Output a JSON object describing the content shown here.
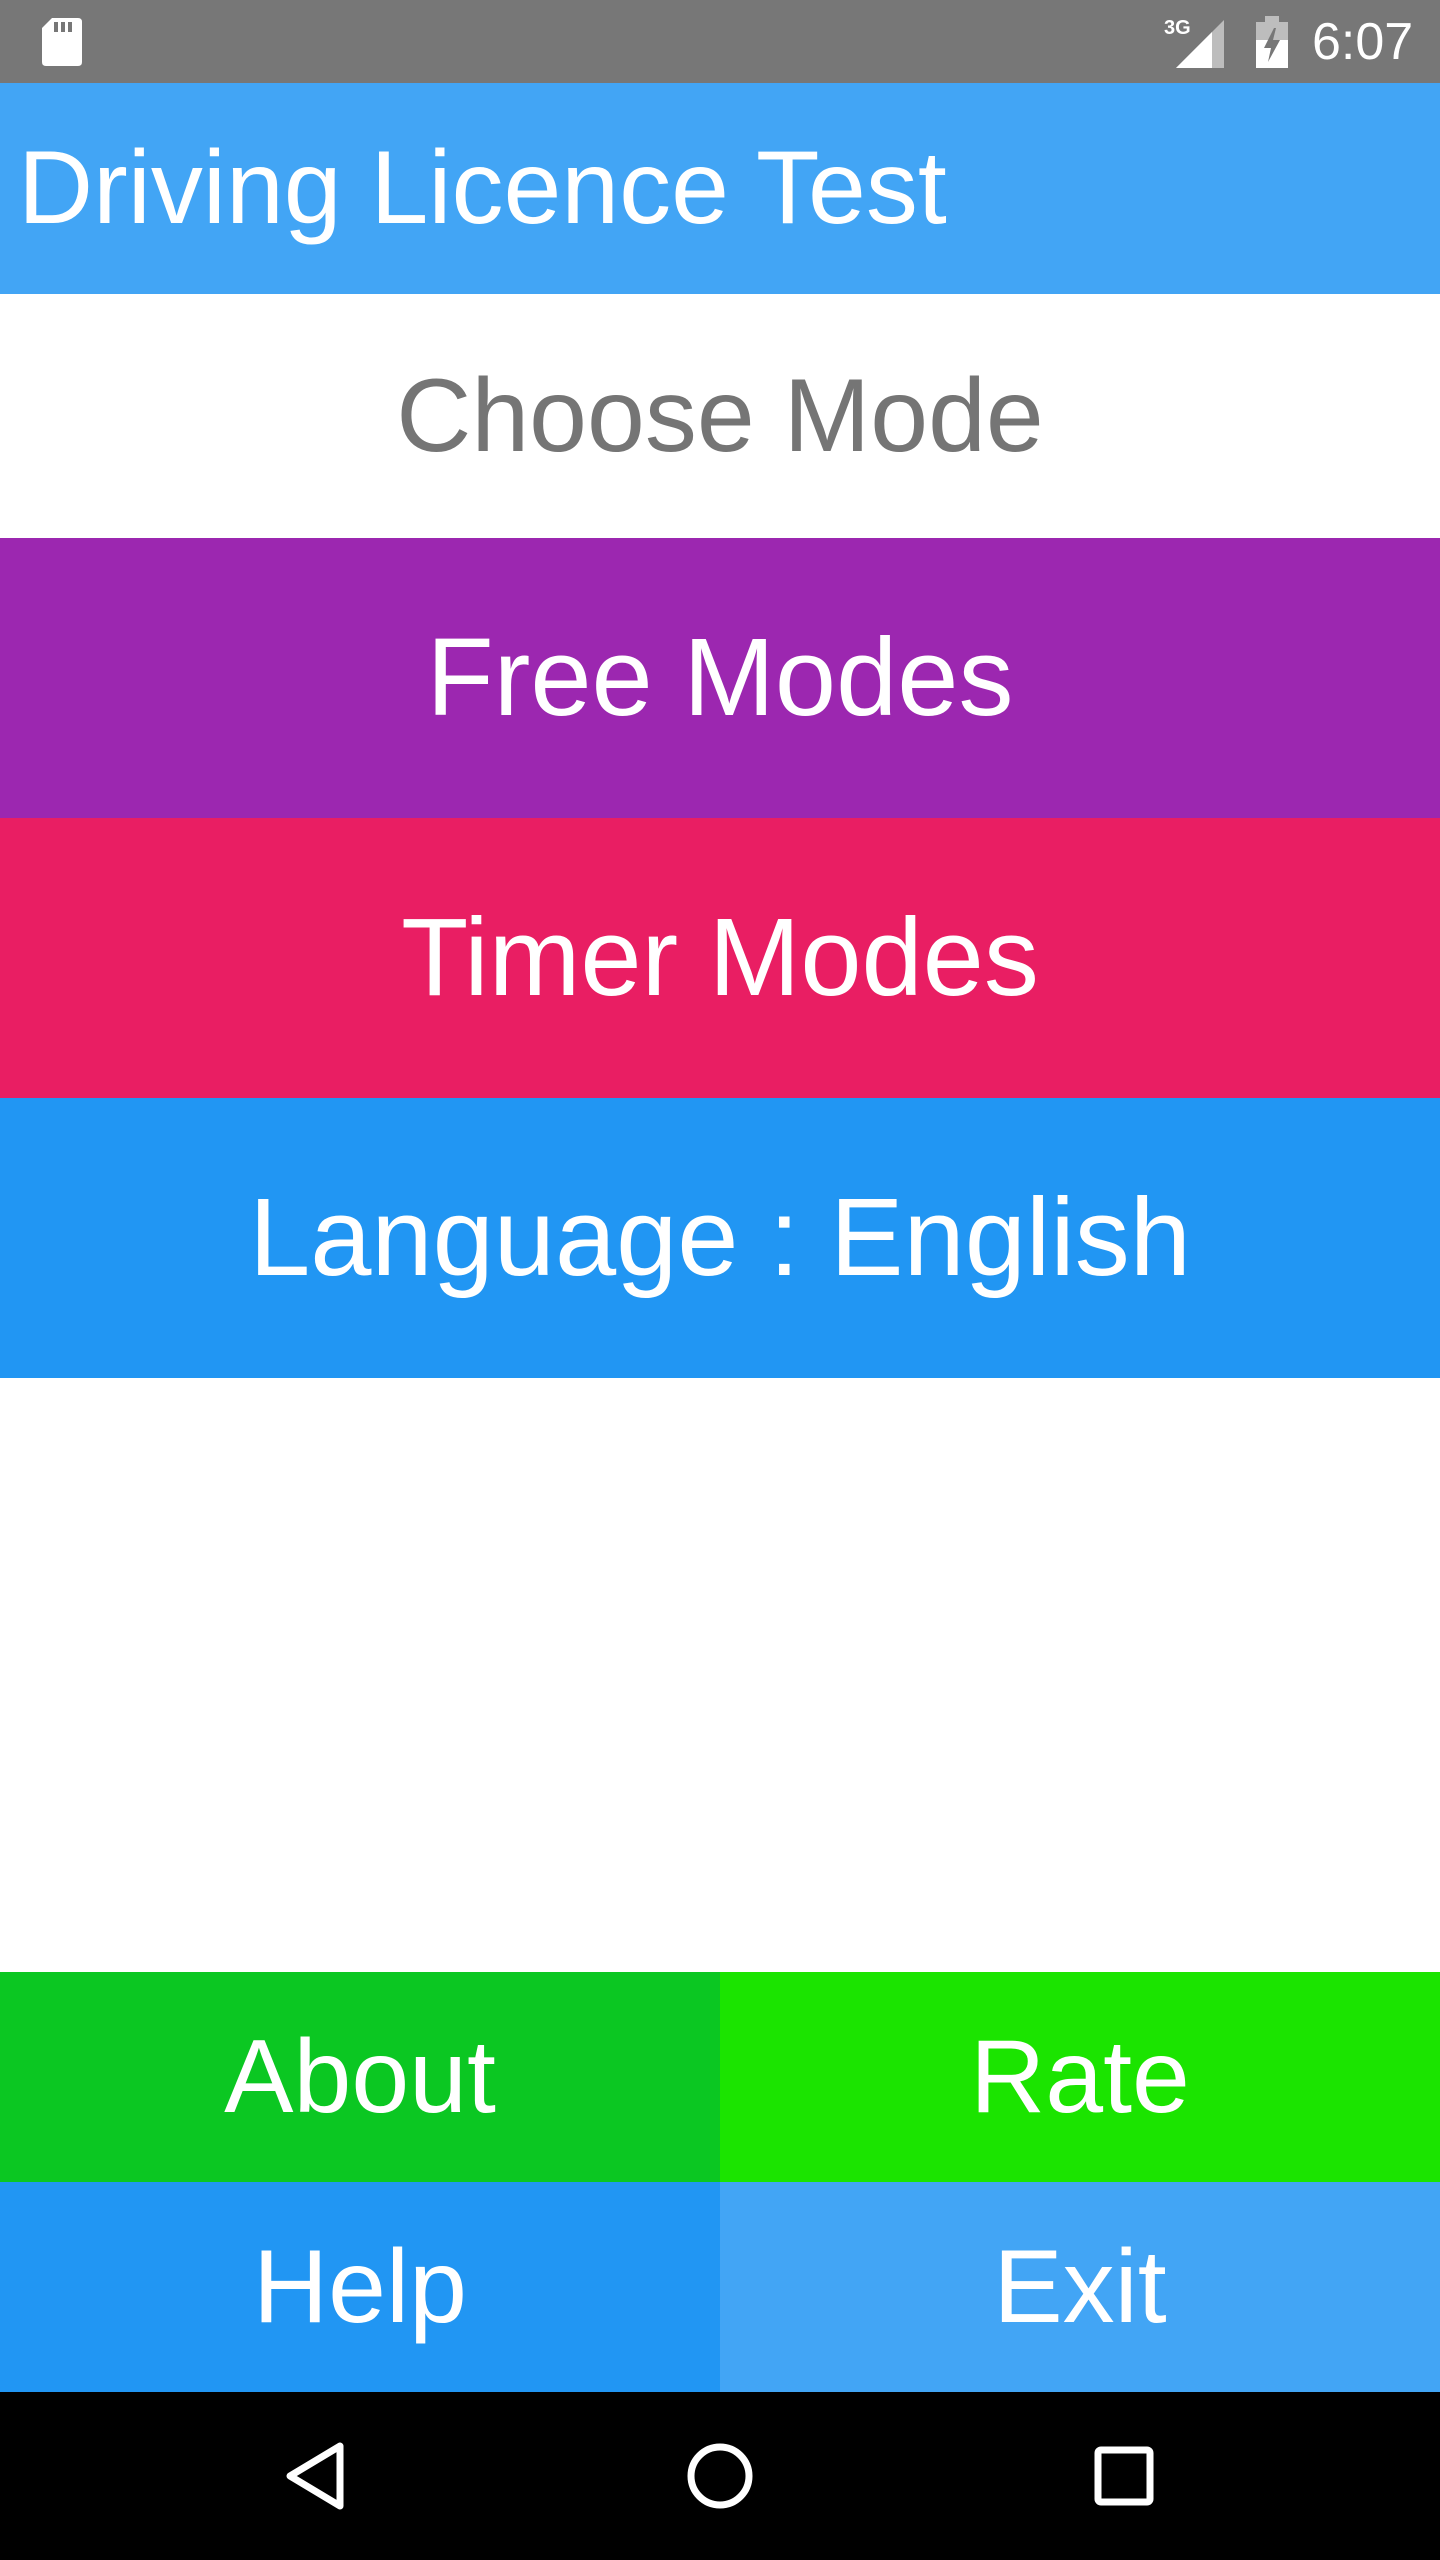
{
  "status_bar": {
    "time": "6:07",
    "network_label": "3G",
    "icons": [
      "sd-card-icon",
      "signal-3g-icon",
      "battery-charging-icon"
    ]
  },
  "app_bar": {
    "title": "Driving Licence Test"
  },
  "main": {
    "heading": "Choose Mode",
    "buttons": [
      {
        "label": "Free Modes",
        "color": "#9c27b0"
      },
      {
        "label": "Timer Modes",
        "color": "#e91e63"
      },
      {
        "label": "Language : English",
        "color": "#2196f3"
      }
    ]
  },
  "footer": {
    "buttons": [
      {
        "label": "About",
        "color": "#0bc722"
      },
      {
        "label": "Rate",
        "color": "#1be400"
      },
      {
        "label": "Help",
        "color": "#2196f3"
      },
      {
        "label": "Exit",
        "color": "#42a5f5"
      }
    ]
  },
  "nav_bar": {
    "icons": [
      "back-icon",
      "home-icon",
      "recent-apps-icon"
    ]
  },
  "colors": {
    "status_bar": "#777777",
    "app_bar": "#42a5f5",
    "heading_text": "#757575"
  }
}
